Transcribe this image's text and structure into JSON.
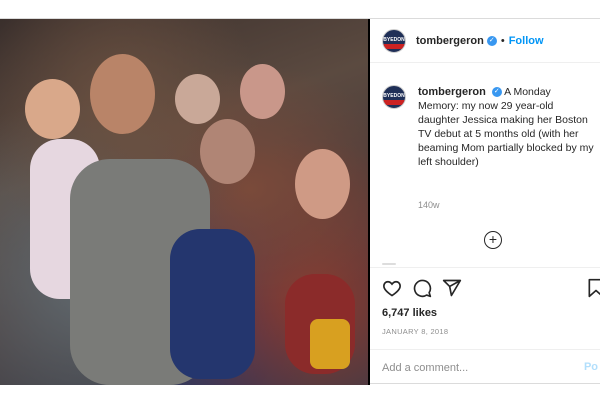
{
  "post": {
    "username": "tombergeron",
    "follow_label": "Follow",
    "dot": "•",
    "verified_icon": "verified-badge-icon",
    "avatar_text": "BYEDON",
    "caption_text": "A Monday Memory: my now 29 year-old daughter Jessica making her Boston TV debut at 5 months old (with her beaming Mom partially blocked by my left shoulder)",
    "time_ago": "140w",
    "likes": "6,747 likes",
    "date": "JANUARY 8, 2018",
    "comment_placeholder": "Add a comment...",
    "post_label": "Po"
  },
  "icons": {
    "like": "heart-icon",
    "comment": "comment-icon",
    "share": "share-icon",
    "save": "bookmark-icon",
    "more_comments": "plus-circle-icon"
  },
  "colors": {
    "accent": "#0095f6",
    "verified": "#3897f0",
    "text": "#262626",
    "muted": "#8e8e8e"
  }
}
